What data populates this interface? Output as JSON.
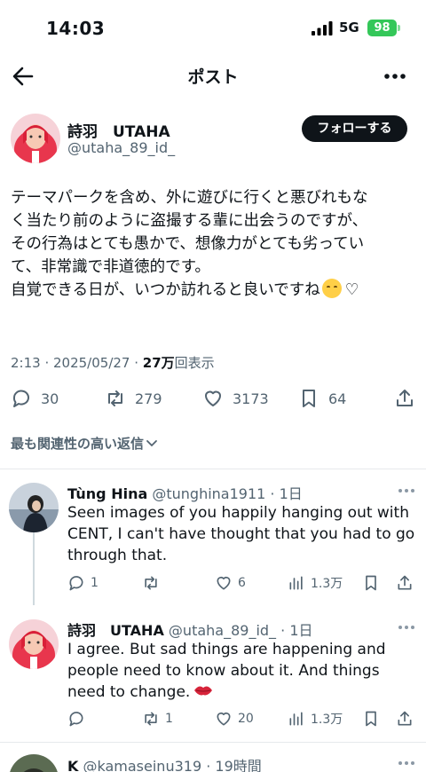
{
  "status": {
    "time": "14:03",
    "network": "5G",
    "battery": "98"
  },
  "header": {
    "title": "ポスト"
  },
  "post": {
    "author_name": "詩羽　UTAHA",
    "author_handle": "@utaha_89_id_",
    "follow_label": "フォローする",
    "body_lines": [
      "テーマパークを含め、外に遊びに行くと悪びれもな",
      "く当たり前のように盗撮する輩に出会うのですが、",
      "その行為はとても愚かで、想像力がとても劣ってい",
      "て、非常識で非道徳的です。",
      "自覚できる日が、いつか訪れると良いですね"
    ],
    "heart_glyph": "♡",
    "time": "2:13",
    "date": "2025/05/27",
    "views_count": "27万",
    "views_label": "回表示",
    "replies": "30",
    "reposts": "279",
    "likes": "3173",
    "bookmarks": "64"
  },
  "sort": {
    "label": "最も関連性の高い返信"
  },
  "replies": [
    {
      "name": "Tùng Hina",
      "handle": "@tunghina1911",
      "time": "1日",
      "lines": [
        "Seen images of you happily hanging out with",
        "CENT, I can't have thought that you had to go",
        "through that."
      ],
      "replies": "1",
      "reposts": "",
      "likes": "6",
      "views": "1.3万"
    },
    {
      "name": "詩羽　UTAHA",
      "handle": "@utaha_89_id_",
      "time": "1日",
      "lines": [
        "I agree. But sad things are happening and",
        "people need to know about it. And things",
        "need to change."
      ],
      "replies": "",
      "reposts": "1",
      "likes": "20",
      "views": "1.3万"
    },
    {
      "name": "K",
      "handle": "@kamaseinu319",
      "time": "19時間"
    }
  ],
  "colors": {
    "accent": "#0f1419",
    "muted": "#536471",
    "battery": "#34c759"
  }
}
